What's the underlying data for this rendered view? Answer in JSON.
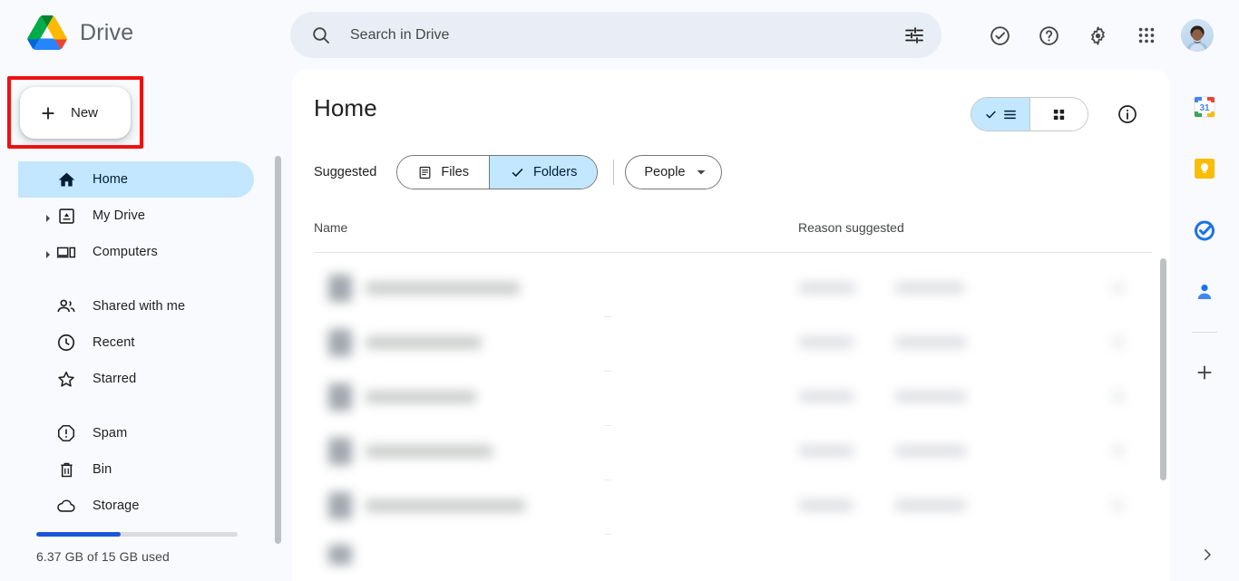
{
  "brand": {
    "name": "Drive",
    "logo_icon": "google-drive-logo"
  },
  "new_button": {
    "label": "New",
    "icon": "plus-icon",
    "highlight_color": "#ee1111"
  },
  "search": {
    "placeholder": "Search in Drive",
    "value": "",
    "search_icon": "search-icon",
    "tune_icon": "tune-filter-icon"
  },
  "header_icons": [
    {
      "name": "tasks-check-icon",
      "label": "Tasks"
    },
    {
      "name": "help-icon",
      "label": "Support"
    },
    {
      "name": "gear-icon",
      "label": "Settings"
    },
    {
      "name": "apps-grid-icon",
      "label": "Google apps"
    }
  ],
  "account": {
    "avatar_label": "Google Account",
    "avatar_icon": "avatar"
  },
  "sidebar": {
    "items": [
      {
        "label": "Home",
        "icon": "home-icon",
        "active": true,
        "expandable": false
      },
      {
        "label": "My Drive",
        "icon": "my-drive-icon",
        "active": false,
        "expandable": true
      },
      {
        "label": "Computers",
        "icon": "computers-icon",
        "active": false,
        "expandable": true
      },
      {
        "label": "Shared with me",
        "icon": "shared-with-me-icon",
        "active": false,
        "expandable": false
      },
      {
        "label": "Recent",
        "icon": "clock-icon",
        "active": false,
        "expandable": false
      },
      {
        "label": "Starred",
        "icon": "star-icon",
        "active": false,
        "expandable": false
      },
      {
        "label": "Spam",
        "icon": "spam-icon",
        "active": false,
        "expandable": false
      },
      {
        "label": "Bin",
        "icon": "trash-icon",
        "active": false,
        "expandable": false
      },
      {
        "label": "Storage",
        "icon": "cloud-icon",
        "active": false,
        "expandable": false
      }
    ],
    "storage": {
      "text": "6.37 GB of 15 GB used",
      "percent": 42,
      "fill_color": "#1a56d6",
      "track_color": "#dadce0"
    }
  },
  "main": {
    "title": "Home",
    "suggested_label": "Suggested",
    "chips": [
      {
        "label": "Files",
        "icon": "file-icon",
        "selected": false
      },
      {
        "label": "Folders",
        "icon": "check-icon",
        "selected": true
      }
    ],
    "people_filter": {
      "label": "People",
      "icon": "chevron-down-icon"
    },
    "view_toggle": {
      "list": {
        "label": "List view",
        "icon": "list-icon",
        "selected": true,
        "check_icon": "check-icon"
      },
      "grid": {
        "label": "Grid view",
        "icon": "grid-icon",
        "selected": false
      }
    },
    "info_button": {
      "label": "View details",
      "icon": "info-icon"
    },
    "table": {
      "columns": [
        "Name",
        "Reason suggested"
      ],
      "rows": [
        {
          "name": "",
          "reason": "",
          "redacted": true
        },
        {
          "name": "",
          "reason": "",
          "redacted": true
        },
        {
          "name": "",
          "reason": "",
          "redacted": true
        },
        {
          "name": "",
          "reason": "",
          "redacted": true
        },
        {
          "name": "",
          "reason": "",
          "redacted": true
        }
      ]
    }
  },
  "right_rail": {
    "apps": [
      {
        "name": "google-calendar-icon",
        "label": "Calendar"
      },
      {
        "name": "google-keep-icon",
        "label": "Keep"
      },
      {
        "name": "google-tasks-icon",
        "label": "Tasks"
      },
      {
        "name": "google-contacts-icon",
        "label": "Contacts"
      }
    ],
    "add_button": {
      "label": "Get Add-ons",
      "icon": "plus-icon"
    },
    "expand_button": {
      "label": "Show side panel",
      "icon": "chevron-right-icon"
    }
  },
  "colors": {
    "page_bg": "#f8fafd",
    "card_bg": "#ffffff",
    "accent_blue": "#c2e7ff",
    "search_bg": "#e9eef6",
    "annotation_red": "#ee1111"
  }
}
